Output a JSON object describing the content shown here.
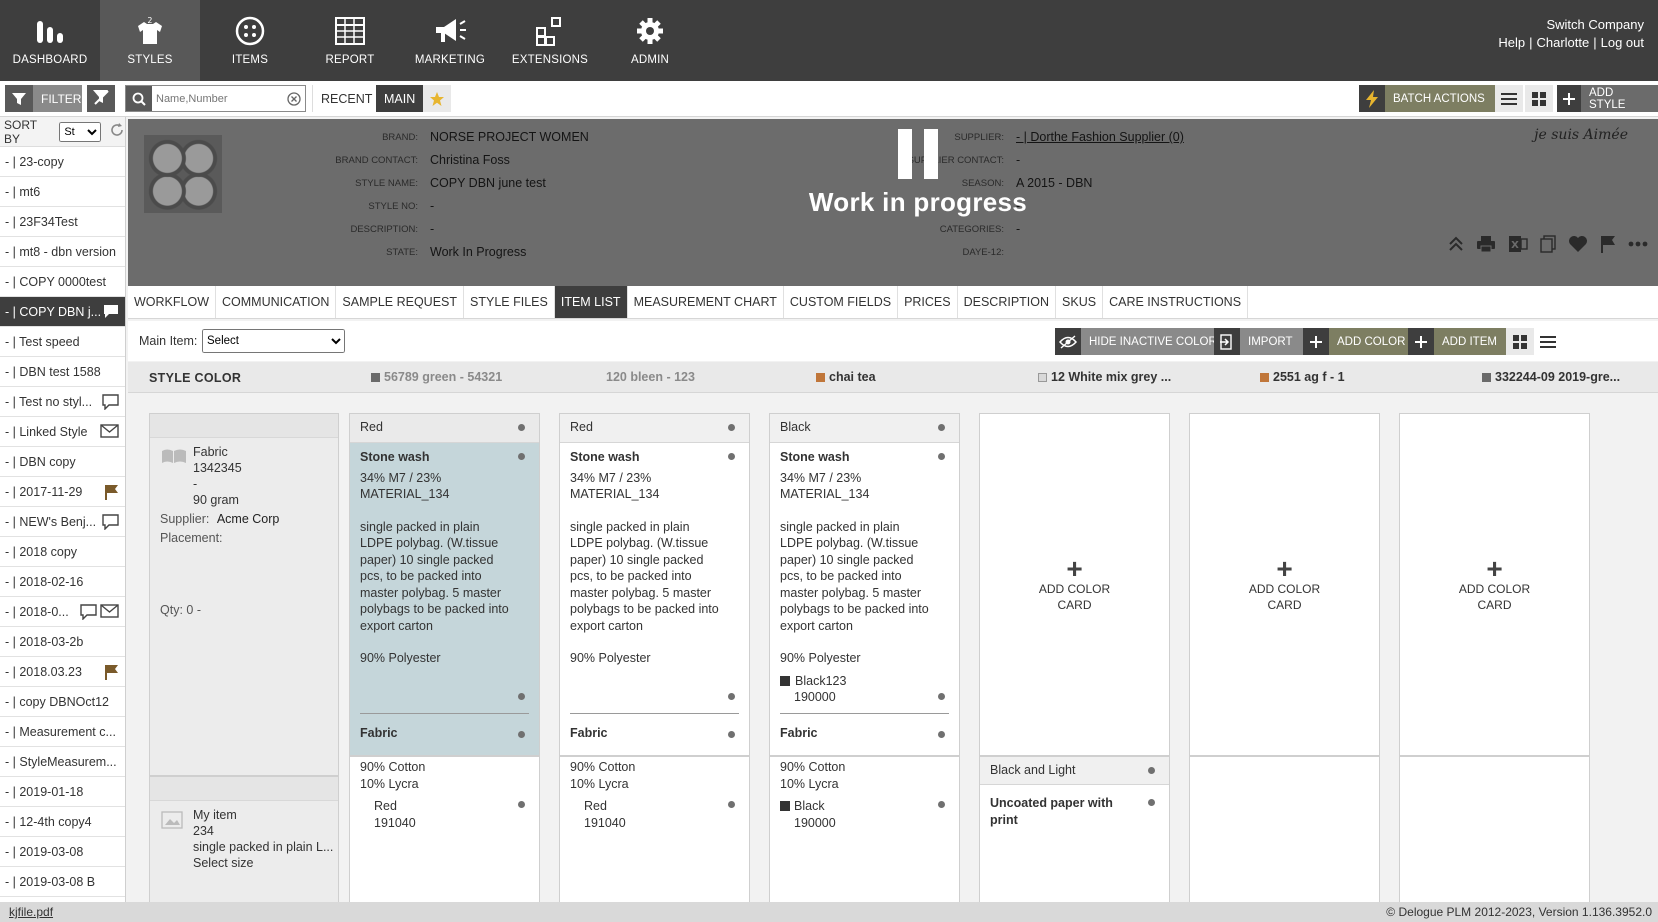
{
  "nav": {
    "items": [
      {
        "label": "DASHBOARD",
        "icon": "dashboard-icon"
      },
      {
        "label": "STYLES",
        "icon": "shirt-icon"
      },
      {
        "label": "ITEMS",
        "icon": "button-icon"
      },
      {
        "label": "REPORT",
        "icon": "table-icon"
      },
      {
        "label": "MARKETING",
        "icon": "megaphone-icon"
      },
      {
        "label": "EXTENSIONS",
        "icon": "extensions-icon"
      },
      {
        "label": "ADMIN",
        "icon": "gear-icon"
      }
    ],
    "company": "Switch Company",
    "help": "Help",
    "user": "Charlotte",
    "logout": "Log out"
  },
  "toolbar": {
    "filter_label": "FILTER",
    "search_placeholder": "Name,Number",
    "recent_label": "RECENT",
    "main_label": "MAIN",
    "batch_label": "BATCH ACTIONS",
    "add_style_label": "ADD STYLE"
  },
  "sidebar": {
    "sort_label": "SORT BY",
    "sort_value": "St",
    "items": [
      {
        "label": "- | 23-copy"
      },
      {
        "label": "- | mt6"
      },
      {
        "label": "- | 23F34Test"
      },
      {
        "label": "- | mt8 - dbn version"
      },
      {
        "label": "- | COPY 0000test"
      },
      {
        "label": "- | COPY DBN j..."
      },
      {
        "label": "- | Test speed"
      },
      {
        "label": "- | DBN test 1588"
      },
      {
        "label": "- | Test no styl..."
      },
      {
        "label": "- | Linked Style"
      },
      {
        "label": "- | DBN copy"
      },
      {
        "label": "- | 2017-11-29"
      },
      {
        "label": "- | NEW's Benj..."
      },
      {
        "label": "- | 2018 copy"
      },
      {
        "label": "- | 2018-02-16"
      },
      {
        "label": "- | 2018-0..."
      },
      {
        "label": "- | 2018-03-2b"
      },
      {
        "label": "- | 2018.03.23"
      },
      {
        "label": "- | copy DBNOct12"
      },
      {
        "label": "- | Measurement c..."
      },
      {
        "label": "- | StyleMeasurem..."
      },
      {
        "label": "- | 2019-01-18"
      },
      {
        "label": "- | 12-4th copy4"
      },
      {
        "label": "- | 2019-03-08"
      },
      {
        "label": "- | 2019-03-08 B"
      }
    ]
  },
  "style": {
    "brand_label": "BRAND:",
    "brand": "NORSE PROJECT WOMEN",
    "brand_contact_label": "BRAND CONTACT:",
    "brand_contact": "Christina Foss",
    "style_name_label": "STYLE NAME:",
    "style_name": "COPY DBN june test",
    "style_no_label": "STYLE NO:",
    "style_no": "-",
    "description_label": "DESCRIPTION:",
    "description": "-",
    "state_label": "STATE:",
    "state": "Work In Progress",
    "supplier_label": "SUPPLIER:",
    "supplier": "- | Dorthe Fashion Supplier (0)",
    "supplier_contact_label": "SUPPLIER CONTACT:",
    "supplier_contact": "-",
    "season_label": "SEASON:",
    "season": "A 2015 - DBN",
    "row4_value": "-",
    "categories_label": "CATEGORIES:",
    "categories": "-",
    "daye_label": "DAYE-12:",
    "wip_text": "Work in progress",
    "brand_logo": "je suis Aimée"
  },
  "tabs": [
    "WORKFLOW",
    "COMMUNICATION",
    "SAMPLE REQUEST",
    "STYLE FILES",
    "ITEM LIST",
    "MEASUREMENT CHART",
    "CUSTOM FIELDS",
    "PRICES",
    "DESCRIPTION",
    "SKUS",
    "CARE INSTRUCTIONS"
  ],
  "item_list": {
    "main_item_label": "Main Item:",
    "main_item_value": "Select",
    "hide_inactive_label": "HIDE INACTIVE COLORS",
    "import_label": "IMPORT",
    "add_color_label": "ADD COLOR",
    "add_item_label": "ADD ITEM",
    "style_color_label": "STYLE COLOR",
    "colors": [
      {
        "label": "56789 green - 54321",
        "swatch": "#6a6a6a",
        "muted": true
      },
      {
        "label": "120 bleen - 123",
        "swatch": "",
        "muted": true
      },
      {
        "label": "chai tea",
        "swatch": "#c0763a",
        "muted": false
      },
      {
        "label": "12 White mix grey ...",
        "swatch": "#d8d8d8",
        "muted": false
      },
      {
        "label": "2551 ag f - 1",
        "swatch": "#c0763a",
        "muted": false
      },
      {
        "label": "332244-09 2019-gre...",
        "swatch": "#6a6a6a",
        "muted": false
      }
    ],
    "item1": {
      "name": "Fabric",
      "number": "1342345",
      "dash": "-",
      "weight": "90 gram",
      "supplier_label": "Supplier:",
      "supplier": "Acme Corp",
      "placement_label": "Placement:",
      "qty": "Qty: 0 -"
    },
    "cards1": [
      {
        "color": "Red",
        "finish": "Stone wash",
        "composition": "34% M7 / 23% MATERIAL_134",
        "packing": "single packed in plain LDPE polybag. (W.tissue paper) 10 single packed pcs, to be packed into master polybag. 5 master polybags to be packed into export carton",
        "material": "90% Polyester",
        "swatch_name": "",
        "swatch_code": "",
        "footer": "Fabric"
      },
      {
        "color": "Red",
        "finish": "Stone wash",
        "composition": "34% M7 / 23% MATERIAL_134",
        "packing": "single packed in plain LDPE polybag. (W.tissue paper) 10 single packed pcs, to be packed into master polybag. 5 master polybags to be packed into export carton",
        "material": "90% Polyester",
        "swatch_name": "",
        "swatch_code": "",
        "footer": "Fabric"
      },
      {
        "color": "Black",
        "finish": "Stone wash",
        "composition": "34% M7 / 23% MATERIAL_134",
        "packing": "single packed in plain LDPE polybag. (W.tissue paper) 10 single packed pcs, to be packed into master polybag. 5 master polybags to be packed into export carton",
        "material": "90% Polyester",
        "swatch_name": "Black123",
        "swatch_code": "190000",
        "footer": "Fabric"
      }
    ],
    "add_color_card": "ADD COLOR CARD",
    "item2": {
      "name": "My item",
      "number": "234",
      "desc": "single packed in plain L...",
      "size": "Select size"
    },
    "cards2": [
      {
        "line1": "90% Cotton",
        "line2": "10% Lycra",
        "color": "Red",
        "code": "191040",
        "swatch": ""
      },
      {
        "line1": "90% Cotton",
        "line2": "10% Lycra",
        "color": "Red",
        "code": "191040",
        "swatch": ""
      },
      {
        "line1": "90% Cotton",
        "line2": "10% Lycra",
        "color": "Black",
        "code": "190000",
        "swatch": "#333333"
      }
    ],
    "card2_4": {
      "head": "Black and Light",
      "body": "Uncoated paper with print"
    }
  },
  "footer": {
    "file": "kjfile.pdf",
    "copyright": "© Delogue PLM 2012-2023, Version 1.136.3952.0"
  }
}
